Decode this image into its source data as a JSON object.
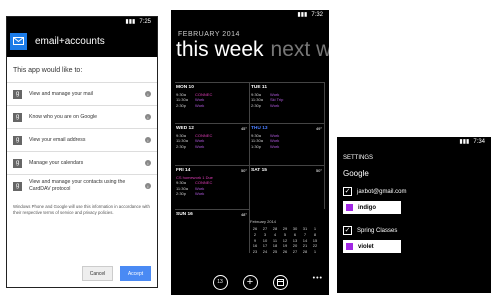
{
  "phone1": {
    "status": {
      "time": "7:25"
    },
    "header_title": "email+accounts",
    "lead": "This app would like to:",
    "permissions": [
      "View and manage your mail",
      "Know who you are on Google",
      "View your email address",
      "Manage your calendars",
      "View and manage your contacts using the CardDAV protocol"
    ],
    "google_glyph": "g",
    "info_glyph": "i",
    "disclaimer": "Windows Phone and Google will use this information in accordance with their respective terms of service and privacy policies.",
    "cancel": "Cancel",
    "accept": "Accept"
  },
  "phone2": {
    "status": {
      "time": "7:32"
    },
    "month": "FEBRUARY 2014",
    "view_title": "this week",
    "next_title": "next w",
    "days": [
      {
        "label": "MON 10",
        "events": [
          [
            "9:30a",
            "CONNEC"
          ],
          [
            "11:30a",
            "Work"
          ],
          [
            "2:30p",
            "Work"
          ]
        ]
      },
      {
        "label": "TUE 11",
        "events": [
          [
            "9:30a",
            "Work"
          ],
          [
            "11:30a",
            "Ski Trip"
          ],
          [
            "2:30p",
            "Work"
          ]
        ]
      },
      {
        "label": "WED 12",
        "temp": "45°",
        "events": [
          [
            "9:30a",
            "CONNEC"
          ],
          [
            "11:30a",
            "Work"
          ],
          [
            "2:30p",
            "Work"
          ]
        ]
      },
      {
        "label": "THU 13",
        "temp": "49°",
        "events": [
          [
            "9:30a",
            "Work"
          ],
          [
            "11:30a",
            "Work"
          ],
          [
            "1:30p",
            "Work"
          ]
        ]
      },
      {
        "label": "FRI 14",
        "temp": "50°",
        "events": [
          [
            "",
            "CS homework 1 Due"
          ],
          [
            "9:30a",
            "CONNEC"
          ],
          [
            "11:30a",
            "Work"
          ],
          [
            "2:30p",
            "Work"
          ]
        ]
      },
      {
        "label": "SAT 15",
        "temp": "50°",
        "events": []
      },
      {
        "label": "SUN 16",
        "temp": "48°",
        "events": []
      }
    ],
    "mini_month": {
      "title": "February 2014",
      "rows": [
        [
          "26",
          "27",
          "28",
          "29",
          "30",
          "31",
          "1"
        ],
        [
          "2",
          "3",
          "4",
          "5",
          "6",
          "7",
          "8"
        ],
        [
          "9",
          "10",
          "11",
          "12",
          "13",
          "14",
          "15"
        ],
        [
          "16",
          "17",
          "18",
          "19",
          "20",
          "21",
          "22"
        ],
        [
          "23",
          "24",
          "25",
          "26",
          "27",
          "28",
          "1"
        ]
      ]
    },
    "appbar": {
      "today": "13",
      "dots": "•••"
    }
  },
  "phone3": {
    "status": {
      "time": "7:34"
    },
    "title": "SETTINGS",
    "section": "Google",
    "accounts": [
      {
        "label": "jaxbot@gmail.com",
        "color": "indigo"
      },
      {
        "label": "Spring Classes",
        "color": "violet"
      }
    ],
    "check_glyph": "✓"
  }
}
